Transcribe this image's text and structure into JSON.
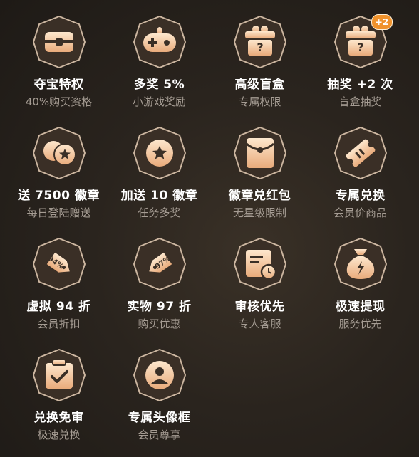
{
  "items": [
    {
      "title": "夺宝特权",
      "sub": "40%购买资格",
      "icon": "treasure-chest-icon"
    },
    {
      "title": "多奖 5%",
      "sub": "小游戏奖励",
      "icon": "gamepad-icon"
    },
    {
      "title": "高级盲盒",
      "sub": "专属权限",
      "icon": "mystery-box-icon"
    },
    {
      "title": "抽奖 +2 次",
      "sub": "盲盒抽奖",
      "icon": "mystery-box-plus-icon"
    },
    {
      "title": "送 7500 徽章",
      "sub": "每日登陆赠送",
      "icon": "coins-star-icon"
    },
    {
      "title": "加送 10 徽章",
      "sub": "任务多奖",
      "icon": "coin-star-icon"
    },
    {
      "title": "徽章兑红包",
      "sub": "无星级限制",
      "icon": "red-envelope-icon"
    },
    {
      "title": "专属兑换",
      "sub": "会员价商品",
      "icon": "ticket-icon"
    },
    {
      "title": "虚拟 94 折",
      "sub": "会员折扣",
      "icon": "price-tag-94-icon"
    },
    {
      "title": "实物 97 折",
      "sub": "购买优惠",
      "icon": "price-tag-97-icon"
    },
    {
      "title": "审核优先",
      "sub": "专人客服",
      "icon": "document-clock-icon"
    },
    {
      "title": "极速提现",
      "sub": "服务优先",
      "icon": "money-bag-icon"
    },
    {
      "title": "兑换免审",
      "sub": "极速兑换",
      "icon": "clipboard-check-icon"
    },
    {
      "title": "专属头像框",
      "sub": "会员尊享",
      "icon": "avatar-frame-icon"
    }
  ],
  "plus_badge": "+2",
  "tag_text": {
    "t94": "94%",
    "t97": "97%"
  },
  "colors": {
    "badge_fill": "#3a2f26",
    "badge_stroke": "#cdb7a1",
    "icon_light": "#fde3c6",
    "icon_dark": "#e7a97a",
    "subtext": "#a59c93"
  }
}
